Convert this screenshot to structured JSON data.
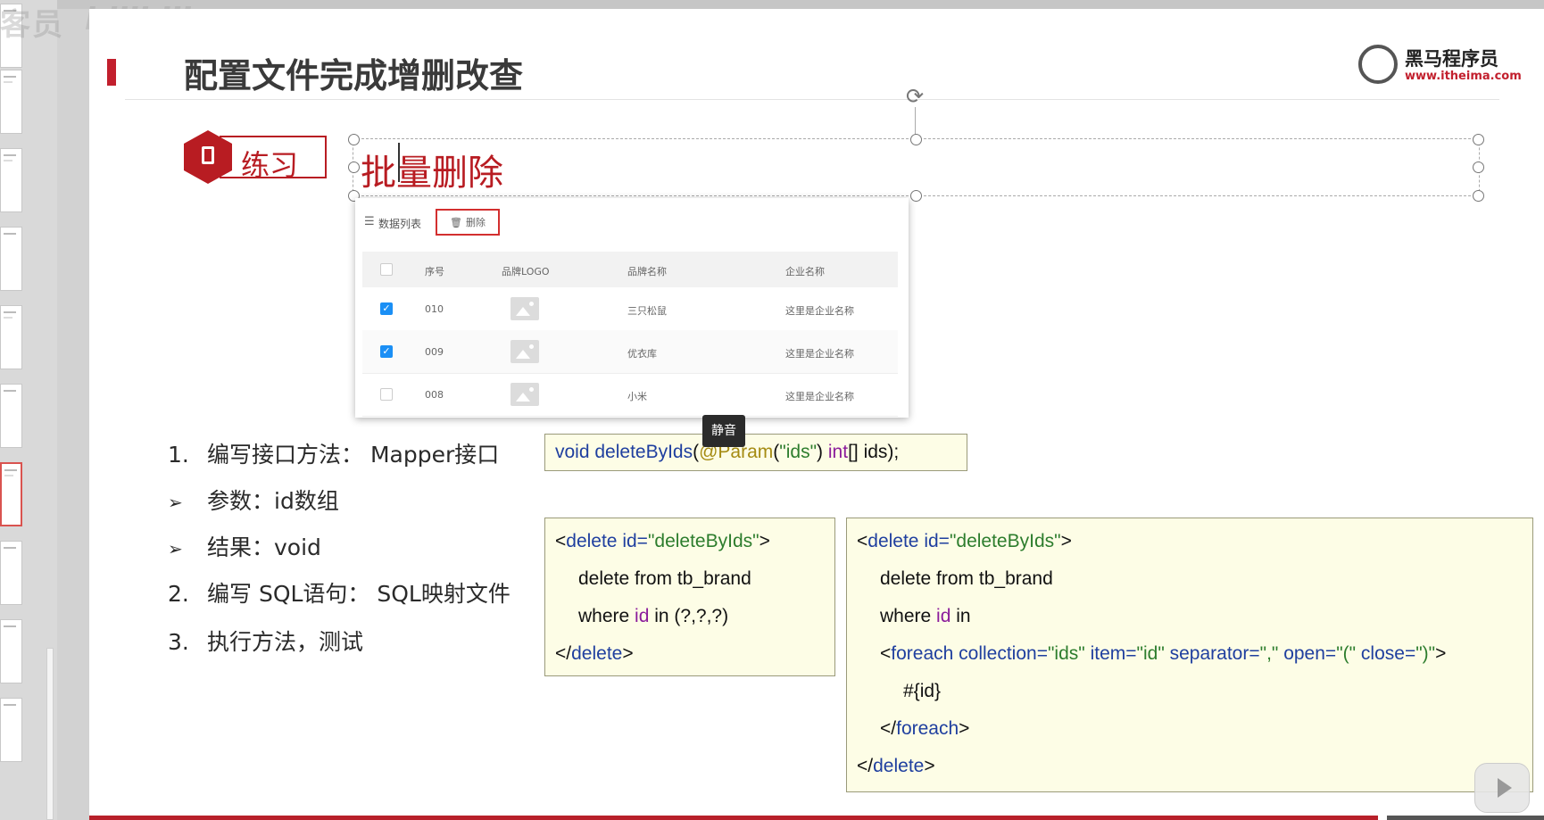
{
  "watermark": {
    "left": "客员",
    "right": "bilibili"
  },
  "slide": {
    "title": "配置文件完成增删改查",
    "logo": {
      "name": "黑马程序员",
      "url": "www.itheima.com"
    },
    "exercise_label": "练习",
    "subtitle": "批量删除"
  },
  "app": {
    "list_title": "数据列表",
    "delete_label": "删除",
    "columns": [
      "序号",
      "品牌LOGO",
      "品牌名称",
      "企业名称"
    ],
    "rows": [
      {
        "id": "010",
        "brand": "三只松鼠",
        "company": "这里是企业名称",
        "checked": true
      },
      {
        "id": "009",
        "brand": "优衣库",
        "company": "这里是企业名称",
        "checked": true
      },
      {
        "id": "008",
        "brand": "小米",
        "company": "这里是企业名称",
        "checked": false
      }
    ]
  },
  "tooltip": "静音",
  "steps": [
    {
      "num": "1.",
      "text": "编写接口方法： Mapper接口"
    },
    {
      "num": "➢",
      "text": "参数：id数组"
    },
    {
      "num": "➢",
      "text": "结果：void"
    },
    {
      "num": "2.",
      "text": "编写 SQL语句： SQL映射文件"
    },
    {
      "num": "3.",
      "text": "执行方法，测试"
    }
  ],
  "code_interface": {
    "p1": "void ",
    "p2": "deleteByIds",
    "p3": "(",
    "p4": "@Param",
    "p5": "(",
    "p6": "\"ids\"",
    "p7": ") ",
    "p8": "int",
    "p9": "[] ids);"
  },
  "code_simple": {
    "l1a": "<",
    "l1b": "delete",
    "l1c": " id=",
    "l1d": "\"deleteByIds\"",
    "l1e": ">",
    "l2": "delete from tb_brand",
    "l3a": "where ",
    "l3b": "id",
    "l3c": " in (?,?,?)",
    "l4a": "</",
    "l4b": "delete",
    "l4c": ">"
  },
  "code_foreach": {
    "l1a": "<",
    "l1b": "delete",
    "l1c": " id=",
    "l1d": "\"deleteByIds\"",
    "l1e": ">",
    "l2": "delete from tb_brand",
    "l3a": "where ",
    "l3b": "id",
    "l3c": " in",
    "l4a": "<",
    "l4b": "foreach",
    "l4c": " collection=",
    "l4d": "\"ids\"",
    "l4e": " item=",
    "l4f": "\"id\"",
    "l4g": " separator=",
    "l4h": "\",\"",
    "l4i": " open=",
    "l4j": "\"(\"",
    "l4k": " close=",
    "l4l": "\")\"",
    "l4m": ">",
    "l5": "#{id}",
    "l6a": "</",
    "l6b": "foreach",
    "l6c": ">",
    "l7a": "</",
    "l7b": "delete",
    "l7c": ">"
  },
  "colors": {
    "accent_red": "#b81c22",
    "code_bg": "#fdfde6",
    "keyword_blue": "#1f3f9f",
    "string_green": "#2d7d2d",
    "checkbox_blue": "#1b8ff5"
  }
}
